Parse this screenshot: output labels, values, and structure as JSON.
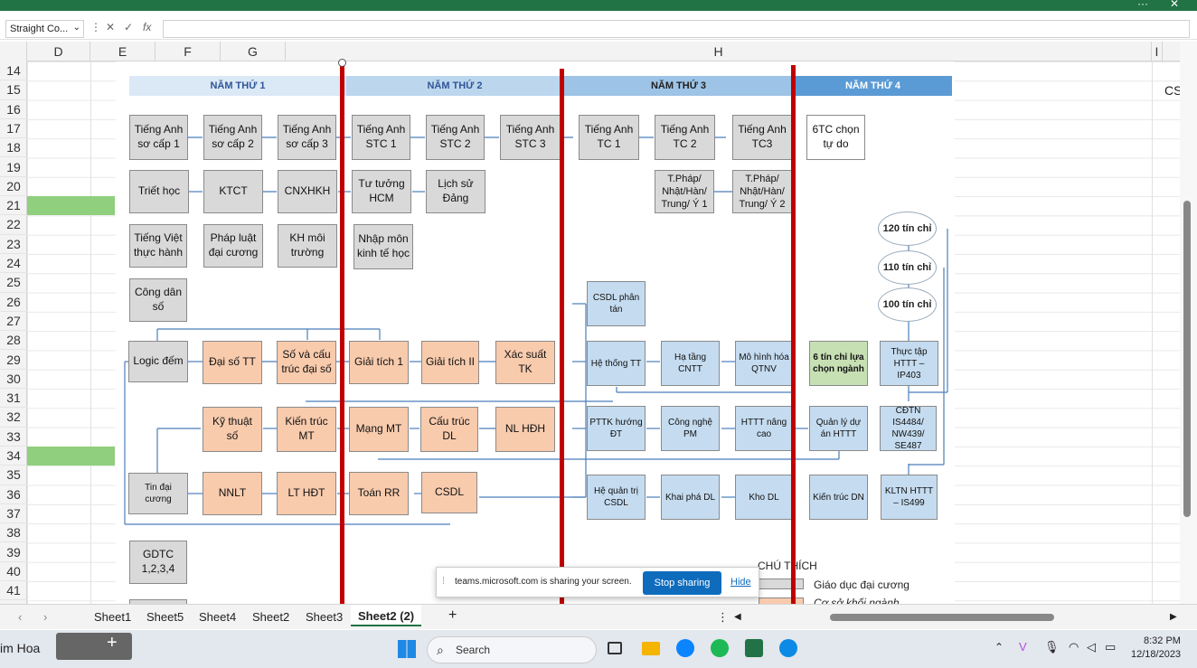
{
  "title_bar": {
    "more": "···",
    "close": "✕"
  },
  "formula_bar": {
    "name_box": "Straight Co...",
    "fx": "fx",
    "cancel": "✕",
    "enter": "✓",
    "value": ""
  },
  "columns": [
    "D",
    "E",
    "F",
    "G",
    "H",
    "I"
  ],
  "rows": [
    "14",
    "15",
    "16",
    "17",
    "18",
    "19",
    "20",
    "21",
    "22",
    "23",
    "24",
    "25",
    "26",
    "27",
    "28",
    "29",
    "30",
    "31",
    "32",
    "33",
    "34",
    "35",
    "36",
    "37",
    "38",
    "39",
    "40",
    "41"
  ],
  "cell_cs": "CS",
  "years": {
    "y1": "NĂM THỨ 1",
    "y2": "NĂM THỨ 2",
    "y3": "NĂM THỨ 3",
    "y4": "NĂM THỨ 4"
  },
  "boxes": {
    "ta_sc1": "Tiếng Anh sơ cấp 1",
    "ta_sc2": "Tiếng Anh sơ cấp 2",
    "ta_sc3": "Tiếng Anh sơ cấp 3",
    "ta_stc1": "Tiếng Anh STC 1",
    "ta_stc2": "Tiếng Anh STC 2",
    "ta_stc3": "Tiếng Anh STC 3",
    "ta_tc1": "Tiếng Anh TC 1",
    "ta_tc2": "Tiếng Anh TC 2",
    "ta_tc3": "Tiếng Anh TC3",
    "tc6": "6TC chọn tự do",
    "triet": "Triết học",
    "ktct": "KTCT",
    "cnxh": "CNXHKH",
    "tthcm": "Tư tưởng HCM",
    "lsd": "Lịch sử Đảng",
    "tphap1": "T.Pháp/ Nhật/Hàn/ Trung/ Ý 1",
    "tphap2": "T.Pháp/ Nhật/Hàn/ Trung/ Ý 2",
    "tvth": "Tiếng Việt thực hành",
    "pldc": "Pháp luật đại cương",
    "khmt": "KH môi trường",
    "nmkth": "Nhập môn kinh tế học",
    "cds": "Công dân số",
    "logic": "Logic đếm",
    "dstt": "Đại số TT",
    "socau": "Số và cấu trúc đại số",
    "gt1": "Giải tích 1",
    "gt2": "Giải tích II",
    "xstk": "Xác suất TK",
    "ktso": "Kỹ thuật số",
    "ktmt": "Kiến trúc MT",
    "mangmt": "Mạng MT",
    "ctdl": "Cấu trúc DL",
    "nlhdh": "NL HĐH",
    "tindc": "Tin đại cương",
    "nnlt": "NNLT",
    "lthdt": "LT HĐT",
    "toanrr": "Toán RR",
    "csdl": "CSDL",
    "gdtc": "GDTC 1,2,3,4",
    "csdlpt": "CSDL phân tán",
    "httt": "Hệ thống TT",
    "htcntt": "Hạ tầng CNTT",
    "mhqtnv": "Mô hình hóa QTNV",
    "pttk": "PTTK hướng ĐT",
    "cnpm": "Công nghệ PM",
    "htttnc": "HTTT nâng cao",
    "hqtcsdl": "Hệ quản trị CSDL",
    "kpdl": "Khai phá DL",
    "khodl": "Kho DL",
    "tc6nganh": "6 tín chỉ lựa chọn ngành",
    "qlda": "Quản lý dự án HTTT",
    "ktdn": "Kiến trúc DN",
    "tt": "Thực tập HTTT – IP403",
    "cdtn": "CĐTN IS4484/ NW439/ SE487",
    "kltn": "KLTN HTTT – IS499",
    "tc120": "120 tín chỉ",
    "tc110": "110 tín chỉ",
    "tc100": "100 tín chỉ"
  },
  "legend": {
    "title": "CHÚ THÍCH",
    "item1": "Giáo dục đại cương",
    "item2": "Cơ sở khối ngành"
  },
  "sharing": {
    "message": "teams.microsoft.com is sharing your screen.",
    "stop": "Stop sharing",
    "hide": "Hide"
  },
  "sheets": [
    "Sheet1",
    "Sheet5",
    "Sheet4",
    "Sheet2",
    "Sheet3",
    "Sheet2 (2)"
  ],
  "active_sheet": "Sheet2 (2)",
  "taskbar": {
    "user": "im Hoa",
    "search": "Search",
    "time": "8:32 PM",
    "date": "12/18/2023"
  },
  "colors": {
    "excel_green": "#217346",
    "red_divider": "#c00000",
    "year_light": "#dbe8f6",
    "year_mid": "#bcd6ee",
    "year_dark": "#5b9bd5",
    "gray_box": "#d9d9d9",
    "orange_box": "#f8cbad",
    "blue_box": "#c5dcf0",
    "green_box": "#c6e0b4",
    "row_highlight": "#8fcf7e"
  }
}
